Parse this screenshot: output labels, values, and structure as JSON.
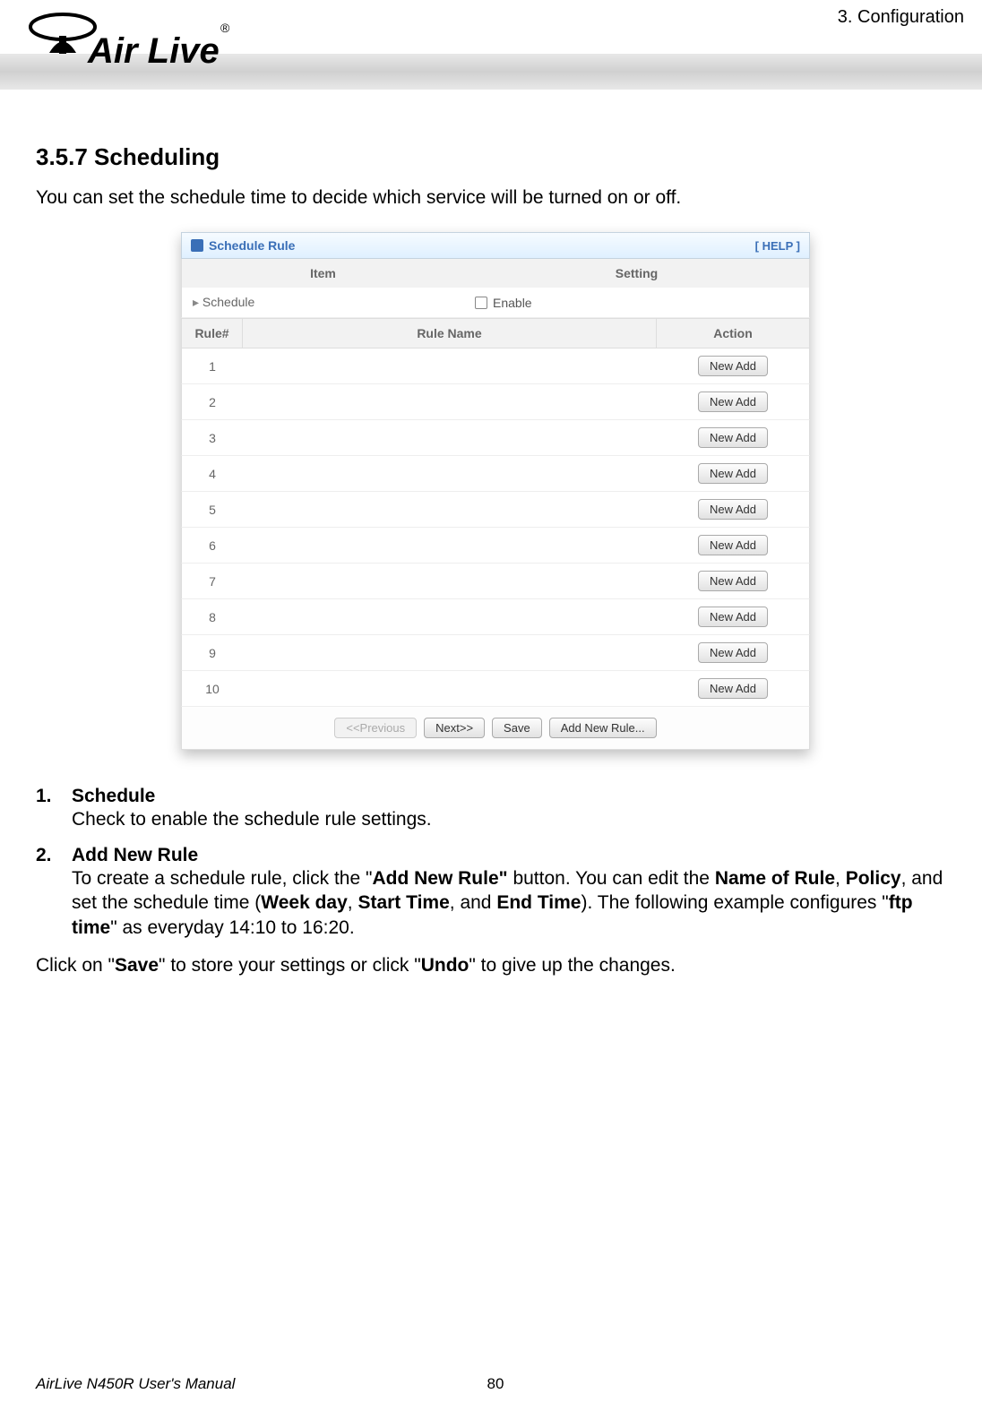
{
  "header": {
    "chapter": "3. Configuration",
    "logo_text": "Air Live",
    "logo_reg": "®"
  },
  "section": {
    "heading": "3.5.7 Scheduling",
    "intro": "You can set the schedule time to decide which service will be turned on or off."
  },
  "screenshot": {
    "panel_title": "Schedule Rule",
    "help_link": "[ HELP ]",
    "item_header": "Item",
    "setting_header": "Setting",
    "schedule_label": "Schedule",
    "enable_label": "Enable",
    "table": {
      "headers": {
        "rule": "Rule#",
        "name": "Rule Name",
        "action": "Action"
      },
      "rows": [
        {
          "num": "1",
          "name": "",
          "action": "New Add"
        },
        {
          "num": "2",
          "name": "",
          "action": "New Add"
        },
        {
          "num": "3",
          "name": "",
          "action": "New Add"
        },
        {
          "num": "4",
          "name": "",
          "action": "New Add"
        },
        {
          "num": "5",
          "name": "",
          "action": "New Add"
        },
        {
          "num": "6",
          "name": "",
          "action": "New Add"
        },
        {
          "num": "7",
          "name": "",
          "action": "New Add"
        },
        {
          "num": "8",
          "name": "",
          "action": "New Add"
        },
        {
          "num": "9",
          "name": "",
          "action": "New Add"
        },
        {
          "num": "10",
          "name": "",
          "action": "New Add"
        }
      ]
    },
    "footer_buttons": {
      "prev": "<<Previous",
      "next": "Next>>",
      "save": "Save",
      "add": "Add New Rule..."
    }
  },
  "list": {
    "items": [
      {
        "num": "1.",
        "title": "Schedule",
        "body_parts": [
          "Check to enable the schedule rule settings."
        ]
      },
      {
        "num": "2.",
        "title": "Add New Rule",
        "body_parts": [
          "To create a schedule rule, click the \"",
          {
            "bold": "Add New Rule\""
          },
          " button. You can edit the ",
          {
            "bold": "Name of Rule"
          },
          ", ",
          {
            "bold": "Policy"
          },
          ", and set the schedule time (",
          {
            "bold": "Week day"
          },
          ", ",
          {
            "bold": "Start Time"
          },
          ", and ",
          {
            "bold": "End Time"
          },
          "). The following example configures \"",
          {
            "bold": "ftp time"
          },
          "\" as everyday 14:10 to 16:20."
        ]
      }
    ],
    "closing_parts": [
      "Click on \"",
      {
        "bold": "Save"
      },
      "\" to store your settings or click \"",
      {
        "bold": "Undo"
      },
      "\" to give up the changes."
    ]
  },
  "footer": {
    "manual": "AirLive N450R User's Manual",
    "page": "80"
  }
}
